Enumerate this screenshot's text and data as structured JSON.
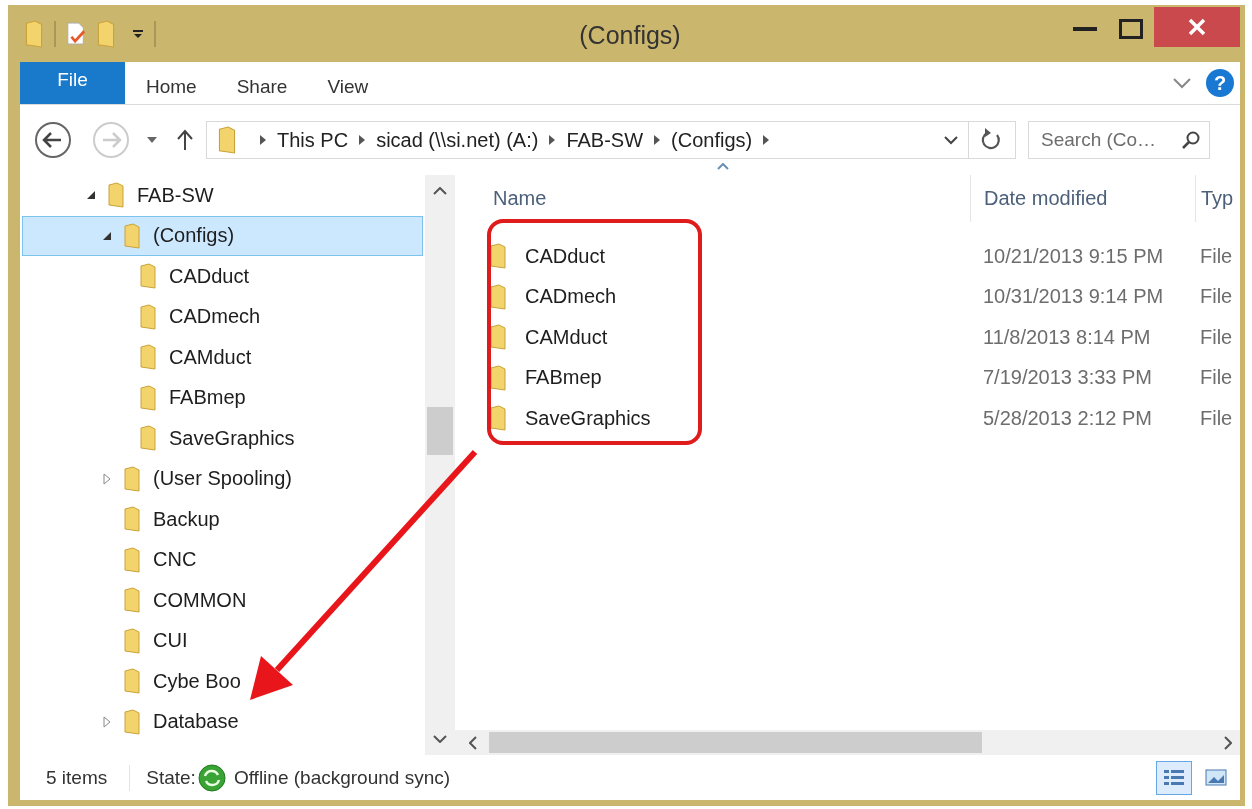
{
  "window": {
    "title": "(Configs)"
  },
  "ribbon": {
    "file_tab": "File",
    "tabs": [
      "Home",
      "Share",
      "View"
    ],
    "help": "?"
  },
  "address": {
    "path": [
      "This PC",
      "sicad (\\\\si.net) (A:)",
      "FAB-SW",
      "(Configs)"
    ]
  },
  "search": {
    "placeholder": "Search (Co…"
  },
  "tree": [
    {
      "label": "FAB-SW",
      "expanded": true,
      "selected": false,
      "children": [
        {
          "label": "(Configs)",
          "expanded": true,
          "selected": true,
          "children": [
            {
              "label": "CADduct",
              "has_children": false,
              "selected": false
            },
            {
              "label": "CADmech",
              "has_children": false,
              "selected": false
            },
            {
              "label": "CAMduct",
              "has_children": false,
              "selected": false
            },
            {
              "label": "FABmep",
              "has_children": false,
              "selected": false
            },
            {
              "label": "SaveGraphics",
              "has_children": false,
              "selected": false
            }
          ]
        },
        {
          "label": "(User Spooling)",
          "has_children": true,
          "expanded": false,
          "selected": false
        },
        {
          "label": "Backup",
          "has_children": false,
          "selected": false
        },
        {
          "label": "CNC",
          "has_children": false,
          "selected": false
        },
        {
          "label": "COMMON",
          "has_children": false,
          "selected": false
        },
        {
          "label": "CUI",
          "has_children": false,
          "selected": false
        },
        {
          "label": "Cybe Boo",
          "has_children": false,
          "selected": false
        },
        {
          "label": "Database",
          "has_children": true,
          "expanded": false,
          "selected": false
        }
      ]
    }
  ],
  "columns": [
    "Name",
    "Date modified",
    "Typ"
  ],
  "rows": [
    {
      "name": "CADduct",
      "date_modified": "10/21/2013 9:15 PM",
      "type": "File"
    },
    {
      "name": "CADmech",
      "date_modified": "10/31/2013 9:14 PM",
      "type": "File"
    },
    {
      "name": "CAMduct",
      "date_modified": "11/8/2013 8:14 PM",
      "type": "File"
    },
    {
      "name": "FABmep",
      "date_modified": "7/19/2013 3:33 PM",
      "type": "File"
    },
    {
      "name": "SaveGraphics",
      "date_modified": "5/28/2013 2:12 PM",
      "type": "File"
    }
  ],
  "status_bar": {
    "item_count": "5 items",
    "state_label": "State:",
    "state": "Offline (background sync)",
    "views": [
      {
        "kind": "details",
        "selected": true
      },
      {
        "kind": "large-icons",
        "selected": false
      }
    ]
  }
}
